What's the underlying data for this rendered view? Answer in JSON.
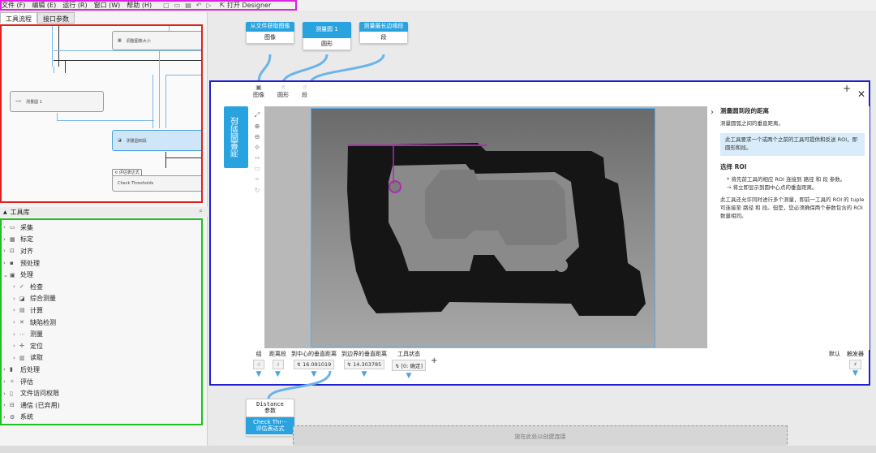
{
  "menubar": {
    "items": [
      "文件 (F)",
      "编辑 (E)",
      "运行 (R)",
      "窗口 (W)",
      "帮助 (H)"
    ],
    "designer_label": "打开 Designer"
  },
  "left_panel": {
    "tabs": [
      "工具流程",
      "接口参数"
    ],
    "flow_nodes": {
      "node1": "调整图像大小",
      "node2": "测量圆 1",
      "node3": "测量圆到段",
      "node4_tag": "评估表达式",
      "node4": "Check Thresholds"
    }
  },
  "toolbox": {
    "title": "工具库",
    "items": [
      {
        "label": "采集",
        "level": 0,
        "expanded": false
      },
      {
        "label": "标定",
        "level": 0,
        "expanded": false
      },
      {
        "label": "对齐",
        "level": 0,
        "expanded": false
      },
      {
        "label": "预处理",
        "level": 0,
        "expanded": false
      },
      {
        "label": "处理",
        "level": 0,
        "expanded": true
      },
      {
        "label": "检查",
        "level": 1,
        "expanded": false
      },
      {
        "label": "综合测量",
        "level": 1,
        "expanded": false
      },
      {
        "label": "计算",
        "level": 1,
        "expanded": false
      },
      {
        "label": "缺陷检测",
        "level": 1,
        "expanded": false
      },
      {
        "label": "测量",
        "level": 1,
        "expanded": false
      },
      {
        "label": "定位",
        "level": 1,
        "expanded": false
      },
      {
        "label": "读取",
        "level": 1,
        "expanded": false
      },
      {
        "label": "后处理",
        "level": 0,
        "expanded": false
      },
      {
        "label": "评估",
        "level": 0,
        "expanded": false
      },
      {
        "label": "文件访问权限",
        "level": 0,
        "expanded": false
      },
      {
        "label": "通信 (已弃用)",
        "level": 0,
        "expanded": false
      },
      {
        "label": "系统",
        "level": 0,
        "expanded": false
      }
    ]
  },
  "canvas": {
    "source_nodes": [
      {
        "title": "从文件获取图像",
        "output": "图像"
      },
      {
        "title": "测量圆 1",
        "output": "圆形"
      },
      {
        "title": "测量最长边缘段",
        "output": "段"
      }
    ],
    "tool": {
      "name": "测量圆到段",
      "inputs": [
        "图像",
        "圆形",
        "段"
      ],
      "help": {
        "title": "测量圆到段的距离",
        "intro": "测量圆弧之间的垂直距离。",
        "note": "此工具要求一个或两个之前的工具可提供和反送 ROI，即圆形和段。",
        "section": "选择 ROI",
        "bullet1": "* 将先前工具的相应 ROI 连接到 路径 和 段 参数。",
        "bullet2": "→ 将立即显示到圆中心点的垂直距离。",
        "para": "此工具还允许同时进行多个测量，即前一工具的 ROI 的 tuple 可连接至 路径 和 段。但是，您必须确保两个参数包含的 ROI 数量相同。"
      },
      "outputs": [
        {
          "label": "组",
          "value": ""
        },
        {
          "label": "距离段",
          "value": ""
        },
        {
          "label": "到中心的垂直距离",
          "value": "16.091019"
        },
        {
          "label": "到边界的垂直距离",
          "value": "14.303785"
        },
        {
          "label": "工具状态",
          "value": "[0: 确定]"
        }
      ],
      "triggers": [
        {
          "label": "默认",
          "value": ""
        },
        {
          "label": "触发器",
          "value": "⚡"
        }
      ]
    },
    "bottom_node": {
      "title": "Distance",
      "subtitle": "参数",
      "name": "Check Thr···",
      "type": "评估表达式"
    },
    "drop_zone": "放在此处以创建连接"
  }
}
